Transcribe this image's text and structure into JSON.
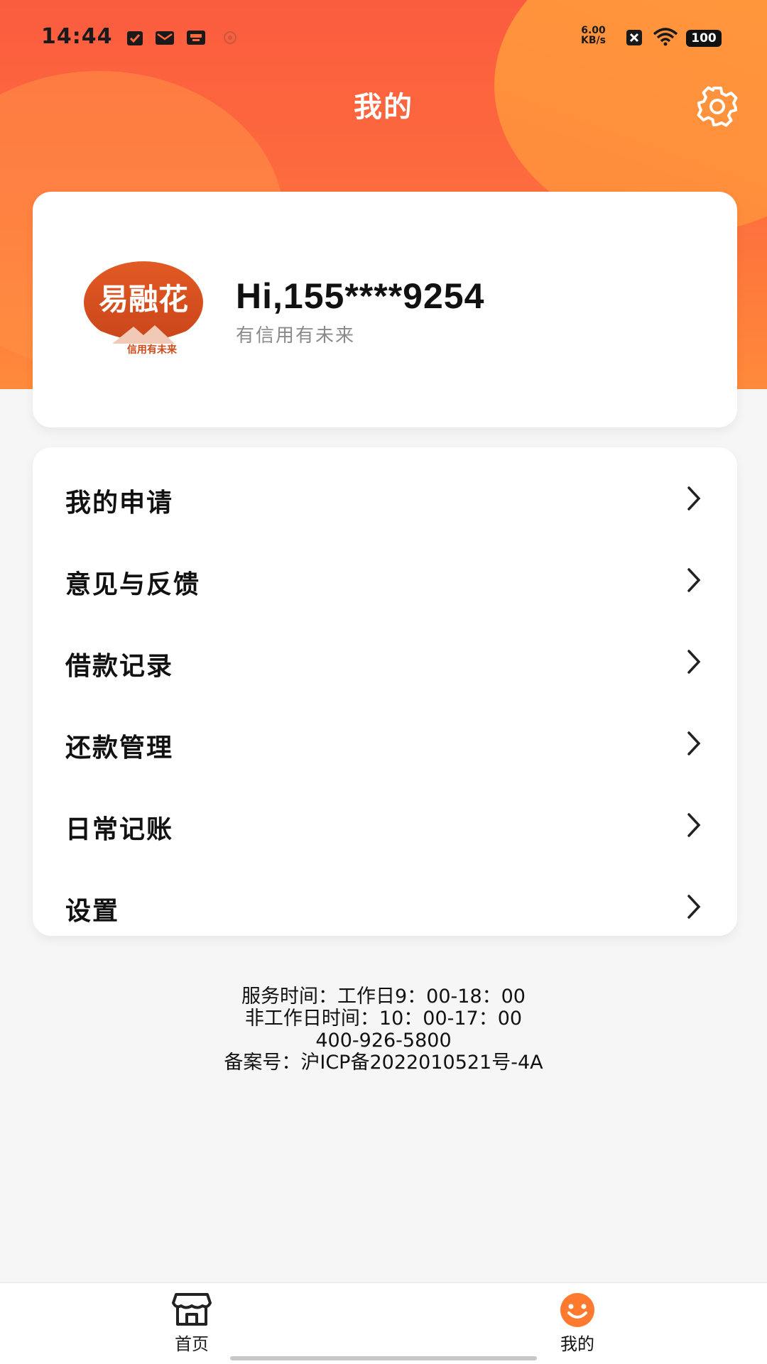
{
  "status_bar": {
    "time": "14:44",
    "net_speed_value": "6.00",
    "net_speed_unit": "KB/s",
    "battery": "100"
  },
  "header": {
    "title": "我的",
    "settings_icon": "gear-icon"
  },
  "profile": {
    "avatar_logo_text": "易融花",
    "avatar_logo_tagline": "信用有未来",
    "greeting": "Hi,155****9254",
    "slogan": "有信用有未来"
  },
  "menu": {
    "items": [
      {
        "label": "我的申请"
      },
      {
        "label": "意见与反馈"
      },
      {
        "label": "借款记录"
      },
      {
        "label": "还款管理"
      },
      {
        "label": "日常记账"
      },
      {
        "label": "设置"
      }
    ]
  },
  "info": {
    "service_hours": "服务时间：工作日9：00-18：00",
    "non_work_hours": "非工作日时间：10：00-17：00",
    "phone": "400-926-5800",
    "icp": "备案号：沪ICP备2022010521号-4A"
  },
  "bottom_nav": {
    "items": [
      {
        "label": "首页",
        "icon": "store-icon",
        "active": false
      },
      {
        "label": "我的",
        "icon": "smiley-icon",
        "active": true
      }
    ]
  },
  "colors": {
    "header_red": "#fb5c3f",
    "header_orange": "#ff8a3a",
    "active_tab": "#ff7a2e"
  }
}
